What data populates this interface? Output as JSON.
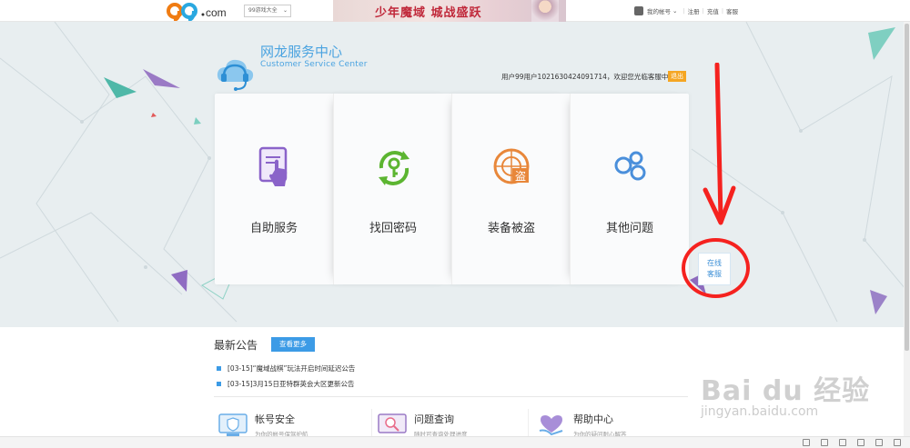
{
  "topbar": {
    "site_logo": "99.com",
    "game_select": "99游戏大全",
    "banner_text": "少年魔域 城战盛跃",
    "account_label": "我的帐号",
    "register": "注册",
    "recharge": "充值",
    "customer_service": "客服"
  },
  "header": {
    "title": "网龙服务中心",
    "subtitle": "Customer Service Center",
    "welcome": "用户99用户1021630424091714，欢迎您光临客服中心",
    "logout": "退出"
  },
  "services": [
    {
      "label": "自助服务",
      "icon": "self-service-icon"
    },
    {
      "label": "找回密码",
      "icon": "key-refresh-icon"
    },
    {
      "label": "装备被盗",
      "icon": "theft-radar-icon"
    },
    {
      "label": "其他问题",
      "icon": "bubbles-icon"
    }
  ],
  "online_service": {
    "line1": "在线",
    "line2": "客服"
  },
  "notices": {
    "title": "最新公告",
    "more": "查看更多",
    "items": [
      "[03-15]“魔域战棋”玩法开启时间延迟公告",
      "[03-15]3月15日亚特群英会大区更新公告"
    ]
  },
  "bottom_services": [
    {
      "title": "帐号安全",
      "sub": "为你的帐号保驾护航",
      "icon": "shield-monitor-icon"
    },
    {
      "title": "问题查询",
      "sub": "随时可查询处理进度",
      "icon": "search-monitor-icon"
    },
    {
      "title": "帮助中心",
      "sub": "为你的疑问耐心解答",
      "icon": "heart-hand-icon"
    }
  ],
  "watermark": {
    "main": "Bai du 经验",
    "sub": "jingyan.baidu.com"
  },
  "colors": {
    "accent": "#3c9be6",
    "logout": "#f5a623",
    "annotation_red": "#f5221f",
    "logo_blue": "#4aa3e0"
  }
}
